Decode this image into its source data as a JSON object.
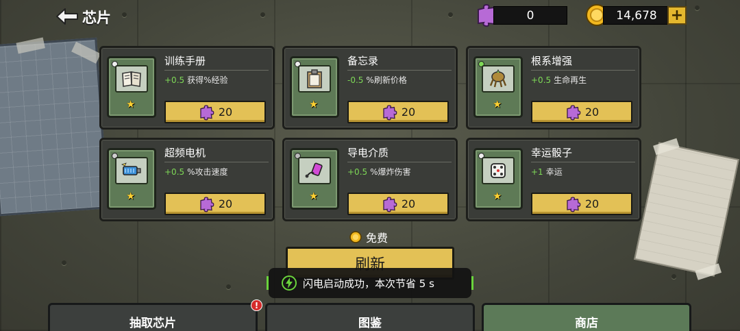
{
  "header": {
    "title": "芯片",
    "puzzle_count": "0",
    "coin_count": "14,678"
  },
  "colors": {
    "accent_gold": "#e3c156",
    "effect_green": "#7ed957",
    "chip_green": "#5e7a56",
    "puzzle_purple": "#b76ad6"
  },
  "cards": [
    {
      "name": "训练手册",
      "value": "+0.5",
      "effect": "获得%经验",
      "price": "20",
      "icon": "book-icon"
    },
    {
      "name": "备忘录",
      "value": "-0.5",
      "effect": "%刷新价格",
      "price": "20",
      "icon": "clipboard-icon"
    },
    {
      "name": "根系增强",
      "value": "+0.5",
      "effect": "生命再生",
      "price": "20",
      "icon": "root-icon"
    },
    {
      "name": "超频电机",
      "value": "+0.5",
      "effect": "%攻击速度",
      "price": "20",
      "icon": "motor-icon"
    },
    {
      "name": "导电介质",
      "value": "+0.5",
      "effect": "%爆炸伤害",
      "price": "20",
      "icon": "battery-icon"
    },
    {
      "name": "幸运骰子",
      "value": "+1",
      "effect": "幸运",
      "price": "20",
      "icon": "dice-icon"
    }
  ],
  "refresh": {
    "cost_label": "免费",
    "button_label": "刷新"
  },
  "toast": {
    "message": "闪电启动成功，本次节省 5 s"
  },
  "tabs": [
    {
      "label": "抽取芯片",
      "active": false
    },
    {
      "label": "图鉴",
      "active": false
    },
    {
      "label": "商店",
      "active": true
    }
  ],
  "badge": {
    "alert_text": "!"
  }
}
